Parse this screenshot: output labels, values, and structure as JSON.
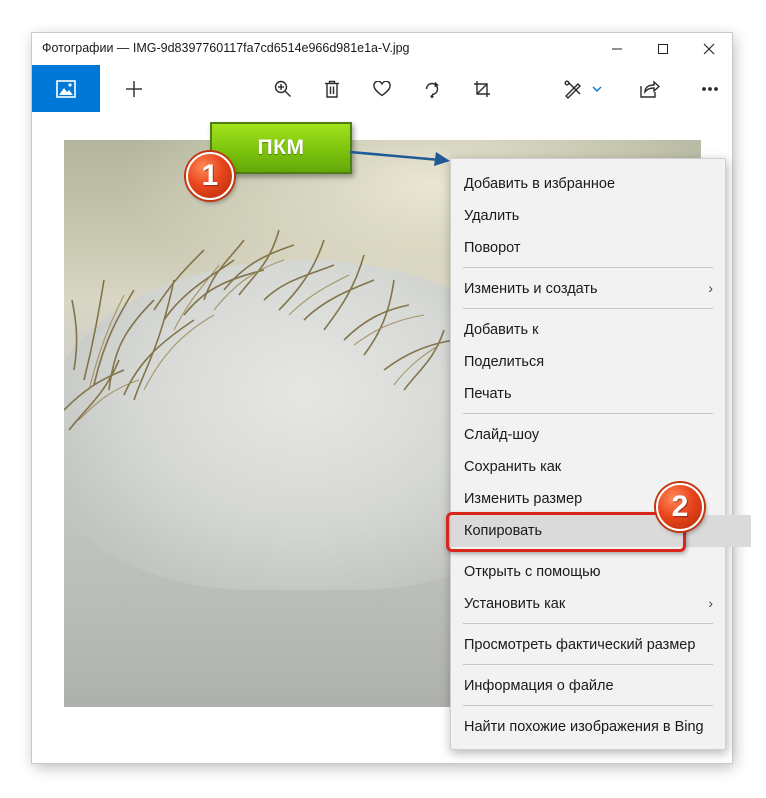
{
  "window": {
    "title": "Фотографии — IMG-9d8397760117fa7cd6514e966d981e1a-V.jpg",
    "minimize_icon": "minimize-icon",
    "maximize_icon": "maximize-icon",
    "close_icon": "close-icon"
  },
  "toolbar": {
    "accent": "#0078d7",
    "icons": [
      "photos-home-icon",
      "add-icon",
      "zoom-in-icon",
      "delete-icon",
      "favorite-heart-icon",
      "rotate-icon",
      "crop-icon",
      "edit-create-icon",
      "chevron-down-icon",
      "share-icon",
      "more-icon"
    ]
  },
  "annotations": {
    "callout_label": "ПКМ",
    "badge_1": "1",
    "badge_2": "2",
    "callout_color": "#7cc40e",
    "badge_color": "#e8461c",
    "highlight_color": "#d9261c"
  },
  "context_menu": {
    "items": [
      {
        "label": "Добавить в избранное"
      },
      {
        "label": "Удалить"
      },
      {
        "label": "Поворот"
      },
      {
        "label": "Изменить и создать",
        "submenu": true
      },
      {
        "label": "Добавить к"
      },
      {
        "label": "Поделиться"
      },
      {
        "label": "Печать"
      },
      {
        "label": "Слайд-шоу"
      },
      {
        "label": "Сохранить как"
      },
      {
        "label": "Изменить размер"
      },
      {
        "label": "Копировать",
        "highlighted": true
      },
      {
        "label": "Открыть с помощью"
      },
      {
        "label": "Установить как",
        "submenu": true
      },
      {
        "label": "Просмотреть фактический размер"
      },
      {
        "label": "Информация о файле"
      },
      {
        "label": "Найти похожие изображения в Bing"
      }
    ],
    "submenu_glyph": "›"
  }
}
